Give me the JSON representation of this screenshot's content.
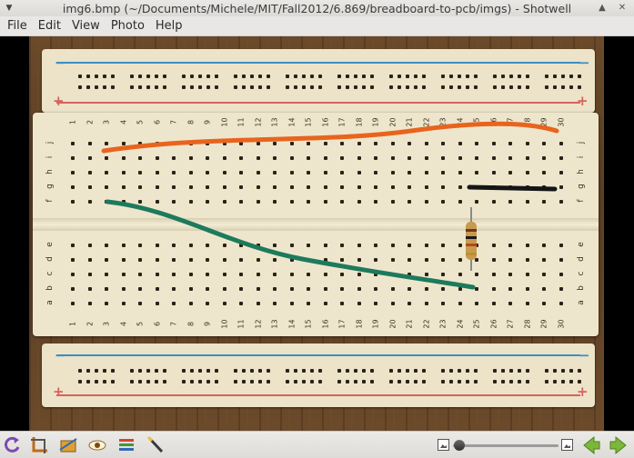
{
  "window": {
    "title": "img6.bmp (~/Documents/Michele/MIT/Fall2012/6.869/breadboard-to-pcb/imgs) - Shotwell"
  },
  "menu": {
    "items": [
      "File",
      "Edit",
      "View",
      "Photo",
      "Help"
    ]
  },
  "breadboard": {
    "column_numbers": [
      "1",
      "2",
      "3",
      "4",
      "5",
      "6",
      "7",
      "8",
      "9",
      "10",
      "11",
      "12",
      "13",
      "14",
      "15",
      "16",
      "17",
      "18",
      "19",
      "20",
      "21",
      "22",
      "23",
      "24",
      "25",
      "26",
      "27",
      "28",
      "29",
      "30"
    ],
    "top_row_letters": [
      "j",
      "i",
      "h",
      "g",
      "f"
    ],
    "bottom_row_letters": [
      "e",
      "d",
      "c",
      "b",
      "a"
    ],
    "rail_minus": "−",
    "rail_plus": "+",
    "wires": [
      {
        "color": "orange",
        "hex": "#e8641e"
      },
      {
        "color": "green",
        "hex": "#1d7a5c"
      },
      {
        "color": "black",
        "hex": "#151515"
      }
    ],
    "component": "resistor"
  },
  "toolbar": {
    "icons": [
      "rotate-icon",
      "crop-icon",
      "straighten-icon",
      "redeye-icon",
      "adjust-icon",
      "enhance-icon"
    ],
    "zoom_level": 0.0
  },
  "colors": {
    "rail_blue": "#3b8fc6",
    "rail_red": "#d6635d",
    "nav_arrow": "#7bb83a"
  }
}
